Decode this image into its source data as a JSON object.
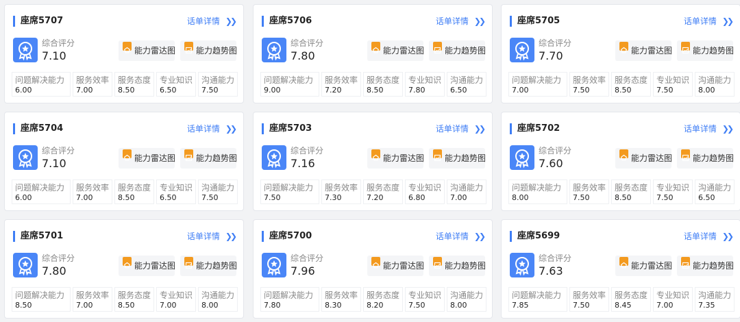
{
  "labels": {
    "detail": "话单详情",
    "score": "综合评分",
    "radar": "能力雷达图",
    "trend": "能力趋势图",
    "metrics": [
      "问题解决能力",
      "服务效率",
      "服务态度",
      "专业知识",
      "沟通能力"
    ]
  },
  "icons": {
    "score": "award-badge-icon",
    "radar": "radar-chart-icon",
    "trend": "trend-chart-icon",
    "chevron": "double-chevron-right-icon"
  },
  "colors": {
    "accent": "#3f7ef5",
    "score_icon": "#4a86f7",
    "action_icon": "#f39a1f"
  },
  "cards": [
    {
      "title": "座席5707",
      "score": "7.10",
      "metrics": [
        "6.00",
        "7.00",
        "8.50",
        "6.50",
        "7.50"
      ]
    },
    {
      "title": "座席5706",
      "score": "7.80",
      "metrics": [
        "9.00",
        "7.20",
        "8.50",
        "7.80",
        "6.50"
      ]
    },
    {
      "title": "座席5705",
      "score": "7.70",
      "metrics": [
        "7.00",
        "7.50",
        "8.50",
        "7.50",
        "8.00"
      ]
    },
    {
      "title": "座席5704",
      "score": "7.10",
      "metrics": [
        "6.00",
        "7.00",
        "8.50",
        "6.50",
        "7.50"
      ]
    },
    {
      "title": "座席5703",
      "score": "7.16",
      "metrics": [
        "7.50",
        "7.30",
        "7.20",
        "6.80",
        "7.00"
      ]
    },
    {
      "title": "座席5702",
      "score": "7.60",
      "metrics": [
        "8.00",
        "7.50",
        "8.50",
        "7.50",
        "6.50"
      ]
    },
    {
      "title": "座席5701",
      "score": "7.80",
      "metrics": [
        "8.50",
        "7.00",
        "8.50",
        "7.00",
        "8.00"
      ]
    },
    {
      "title": "座席5700",
      "score": "7.96",
      "metrics": [
        "7.80",
        "8.30",
        "8.20",
        "7.50",
        "8.00"
      ]
    },
    {
      "title": "座席5699",
      "score": "7.63",
      "metrics": [
        "7.85",
        "7.50",
        "8.45",
        "7.00",
        "7.35"
      ]
    }
  ]
}
